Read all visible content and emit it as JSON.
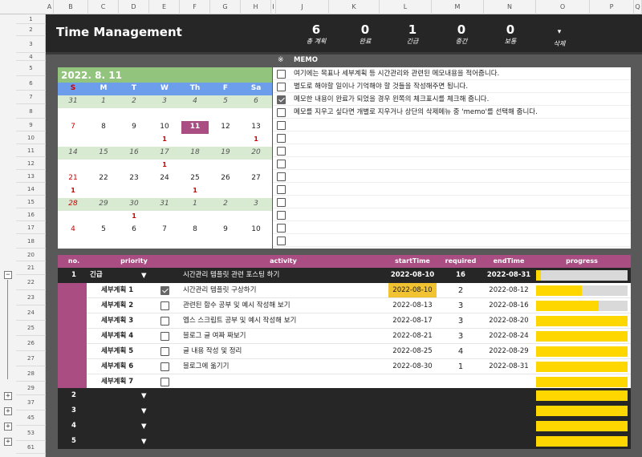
{
  "columns": [
    "A",
    "B",
    "C",
    "D",
    "E",
    "F",
    "G",
    "H",
    "I",
    "J",
    "K",
    "L",
    "M",
    "N",
    "O",
    "P",
    "Q"
  ],
  "rows": [
    "1",
    "2",
    "3",
    "4",
    "5",
    "6",
    "7",
    "8",
    "9",
    "10",
    "11",
    "12",
    "13",
    "14",
    "15",
    "16",
    "17",
    "18",
    "20",
    "21",
    "22",
    "23",
    "24",
    "25",
    "26",
    "27",
    "28",
    "29",
    "37",
    "45",
    "53",
    "61"
  ],
  "header": {
    "title": "Time Management",
    "stats": [
      {
        "value": "6",
        "label": "총 계획"
      },
      {
        "value": "0",
        "label": "완료"
      },
      {
        "value": "1",
        "label": "긴급"
      },
      {
        "value": "0",
        "label": "중간"
      },
      {
        "value": "0",
        "label": "보통"
      }
    ],
    "delete_label": "삭제",
    "dropdown": "▾"
  },
  "calendar": {
    "date": "2022. 8. 11",
    "weekdays": [
      "S",
      "M",
      "T",
      "W",
      "Th",
      "F",
      "Sa"
    ],
    "weeks": [
      {
        "days": [
          "31",
          "1",
          "2",
          "3",
          "4",
          "5",
          "6"
        ],
        "counts": [
          "",
          "",
          "",
          "",
          "",
          "",
          ""
        ]
      },
      {
        "days": [
          "7",
          "8",
          "9",
          "10",
          "11",
          "12",
          "13"
        ],
        "counts": [
          "",
          "",
          "",
          "1",
          "",
          "",
          "1"
        ]
      },
      {
        "days": [
          "14",
          "15",
          "16",
          "17",
          "18",
          "19",
          "20"
        ],
        "counts": [
          "",
          "",
          "",
          "1",
          "",
          "",
          ""
        ]
      },
      {
        "days": [
          "21",
          "22",
          "23",
          "24",
          "25",
          "26",
          "27"
        ],
        "counts": [
          "1",
          "",
          "",
          "",
          "1",
          "",
          ""
        ]
      },
      {
        "days": [
          "28",
          "29",
          "30",
          "31",
          "1",
          "2",
          "3"
        ],
        "counts": [
          "",
          "",
          "1",
          "",
          "",
          "",
          ""
        ]
      },
      {
        "days": [
          "4",
          "5",
          "6",
          "7",
          "8",
          "9",
          "10"
        ],
        "counts": [
          "",
          "",
          "",
          "",
          "",
          "",
          ""
        ]
      }
    ],
    "today_index": [
      1,
      4
    ],
    "colors": {
      "header": "#93c47d",
      "weekday_row": "#6d9eeb",
      "shaded": "#d9ead3",
      "today": "#a94d82",
      "sunday": "#cc0000"
    }
  },
  "memo": {
    "title_mark": "※",
    "title": "MEMO",
    "lines": [
      {
        "text": "여기에는 목표나 세부계획 등 시간관리와 관련된 메모내용을 적어줍니다.",
        "checked": false
      },
      {
        "text": "별도로 해야할 일이나 기억해야 할 것들을 작성해주면 됩니다.",
        "checked": false
      },
      {
        "text": "메모한 내용이 완료가 되었을 경우 왼쪽의 체크표시를 체크해 줍니다.",
        "checked": true
      },
      {
        "text": "메모를 지우고 싶다면 개별로 지우거나 상단의 삭제메뉴 중 'memo'를 선택해 줍니다.",
        "checked": false
      },
      {
        "text": "",
        "checked": false
      },
      {
        "text": "",
        "checked": false
      },
      {
        "text": "",
        "checked": false
      },
      {
        "text": "",
        "checked": false
      },
      {
        "text": "",
        "checked": false
      },
      {
        "text": "",
        "checked": false
      },
      {
        "text": "",
        "checked": false
      },
      {
        "text": "",
        "checked": false
      },
      {
        "text": "",
        "checked": false
      },
      {
        "text": "",
        "checked": false
      }
    ]
  },
  "table": {
    "headers": {
      "no": "no.",
      "priority": "priority",
      "activity": "activity",
      "start": "startTime",
      "required": "required",
      "end": "endTime",
      "progress": "progress"
    },
    "main": {
      "no": "1",
      "priority": "긴급",
      "activity": "시간관리 템플릿 관련 포스팅 하기",
      "start": "2022-08-10",
      "required": "16",
      "end": "2022-08-31",
      "progress": 0.05
    },
    "subs": [
      {
        "label": "세부계획 1",
        "checked": true,
        "activity": "시간관리 템플릿 구상하기",
        "start": "2022-08-10",
        "required": "2",
        "end": "2022-08-12",
        "progress": 0.5,
        "highlight": true
      },
      {
        "label": "세부계획 2",
        "checked": false,
        "activity": "관련된 함수 공부 및 예시 작성해 보기",
        "start": "2022-08-13",
        "required": "3",
        "end": "2022-08-16",
        "progress": 0.68
      },
      {
        "label": "세부계획 3",
        "checked": false,
        "activity": "엡스 스크립트 공부 및 예시 작성해 보기",
        "start": "2022-08-17",
        "required": "3",
        "end": "2022-08-20",
        "progress": 1.0
      },
      {
        "label": "세부계획 4",
        "checked": false,
        "activity": "블로그 글 여짜 짜보기",
        "start": "2022-08-21",
        "required": "3",
        "end": "2022-08-24",
        "progress": 1.0
      },
      {
        "label": "세부계획 5",
        "checked": false,
        "activity": "글 내용 작성 및 정리",
        "start": "2022-08-25",
        "required": "4",
        "end": "2022-08-29",
        "progress": 1.0
      },
      {
        "label": "세부계획 6",
        "checked": false,
        "activity": "블로그에 옮기기",
        "start": "2022-08-30",
        "required": "1",
        "end": "2022-08-31",
        "progress": 1.0
      },
      {
        "label": "세부계획 7",
        "checked": false,
        "activity": "",
        "start": "",
        "required": "",
        "end": "",
        "progress": 1.0
      }
    ],
    "collapsed": [
      {
        "no": "2",
        "progress": 1.0
      },
      {
        "no": "3",
        "progress": 1.0
      },
      {
        "no": "4",
        "progress": 1.0
      },
      {
        "no": "5",
        "progress": 1.0
      }
    ]
  },
  "accent": {
    "magenta": "#a94d82",
    "yellow": "#ffd700",
    "dark": "#262626",
    "gray": "#595959"
  }
}
